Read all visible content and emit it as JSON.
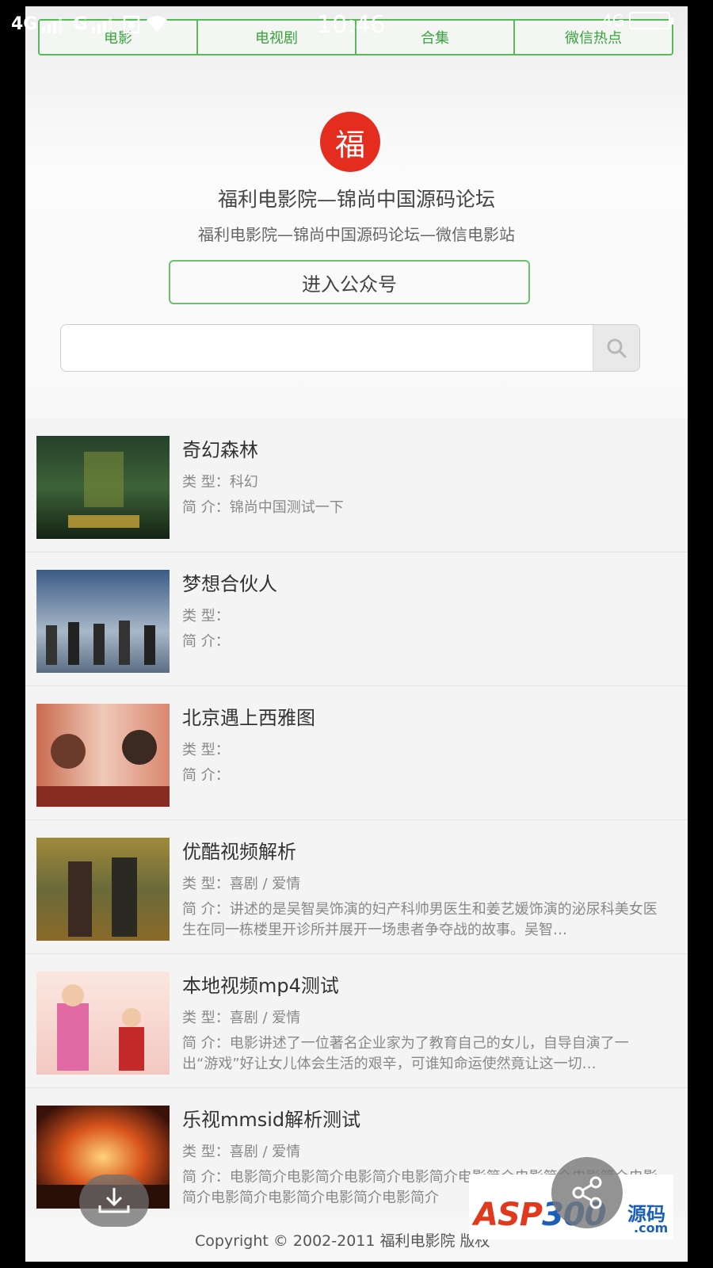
{
  "status_bar": {
    "network_1": "4G",
    "network_2": "G",
    "time": "10:46",
    "network_right": "4G"
  },
  "nav": {
    "tabs": [
      "电影",
      "电视剧",
      "合集",
      "微信热点"
    ]
  },
  "header": {
    "logo_glyph": "福",
    "title": "福利电影院—锦尚中国源码论坛",
    "subtitle": "福利电影院—锦尚中国源码论坛—微信电影站",
    "enter_button": "进入公众号"
  },
  "search": {
    "placeholder": ""
  },
  "movies": [
    {
      "title": "奇幻森林",
      "type_label": "类 型：",
      "type": "科幻",
      "desc_label": "简 介：",
      "desc": "锦尚中国测试一下"
    },
    {
      "title": "梦想合伙人",
      "type_label": "类 型：",
      "type": "",
      "desc_label": "简 介：",
      "desc": ""
    },
    {
      "title": "北京遇上西雅图",
      "type_label": "类 型：",
      "type": "",
      "desc_label": "简 介：",
      "desc": ""
    },
    {
      "title": "优酷视频解析",
      "type_label": "类 型：",
      "type": "喜剧 / 爱情",
      "desc_label": "简 介：",
      "desc": "讲述的是吴智昊饰演的妇产科帅男医生和姜艺媛饰演的泌尿科美女医生在同一栋楼里开诊所并展开一场患者争夺战的故事。吴智…"
    },
    {
      "title": "本地视频mp4测试",
      "type_label": "类 型：",
      "type": "喜剧 / 爱情",
      "desc_label": "简 介：",
      "desc": "电影讲述了一位著名企业家为了教育自己的女儿，自导自演了一出“游戏”好让女儿体会生活的艰辛，可谁知命运使然竟让这一切…"
    },
    {
      "title": "乐视mmsid解析测试",
      "type_label": "类 型：",
      "type": "喜剧 / 爱情",
      "desc_label": "简 介：",
      "desc": "电影简介电影简介电影简介电影简介电影简介电影简介电影简介电影简介电影简介电影简介电影简介电影简介"
    }
  ],
  "footer": {
    "copyright": "Copyright © 2002-2011 福利电影院 版权"
  },
  "watermark": {
    "brand_a": "ASP",
    "brand_b": "300",
    "brand_c": "源码",
    "brand_d": ".com"
  },
  "colors": {
    "accent_green": "#58b85a",
    "logo_red": "#e42c1f"
  }
}
